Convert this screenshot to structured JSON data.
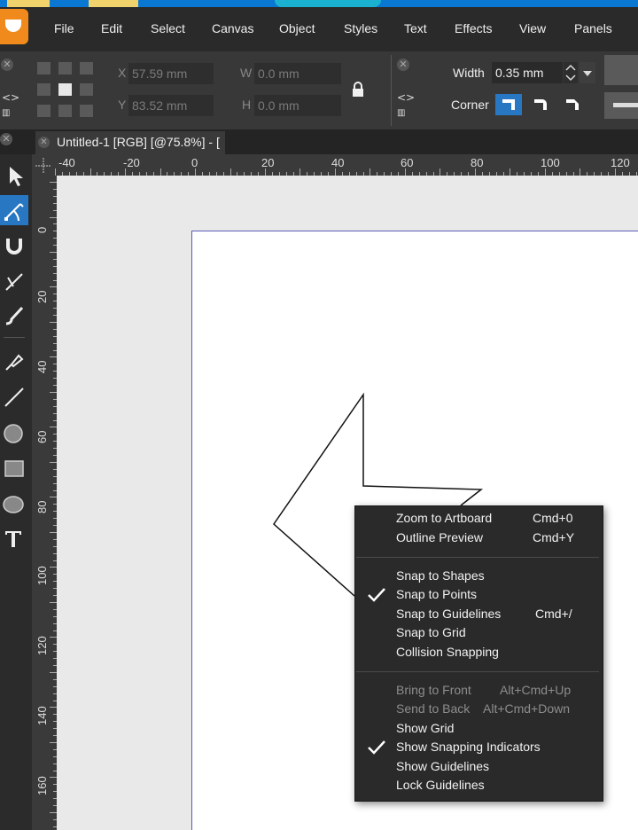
{
  "menu": {
    "items": [
      "File",
      "Edit",
      "Select",
      "Canvas",
      "Object",
      "Styles",
      "Text",
      "Effects",
      "View",
      "Panels"
    ]
  },
  "context_toolbar": {
    "x_label": "X",
    "x_value": "57.59 mm",
    "y_label": "Y",
    "y_value": "83.52 mm",
    "w_label": "W",
    "w_value": "0.0 mm",
    "h_label": "H",
    "h_value": "0.0 mm",
    "width_label": "Width",
    "width_value": "0.35 mm",
    "corner_label": "Corner"
  },
  "document_tab": {
    "title": "Untitled-1 [RGB] [@75.8%] - ["
  },
  "ruler": {
    "horizontal": [
      "-40",
      "-20",
      "0",
      "20",
      "40",
      "60",
      "80",
      "100",
      "120"
    ],
    "vertical": [
      "0",
      "20",
      "40",
      "60",
      "80",
      "100",
      "120",
      "140",
      "160"
    ]
  },
  "context_menu": {
    "group1": [
      {
        "label": "Zoom to Artboard",
        "shortcut": "Cmd+0",
        "enabled": true,
        "checked": false
      },
      {
        "label": "Outline Preview",
        "shortcut": "Cmd+Y",
        "enabled": true,
        "checked": false
      }
    ],
    "group2": [
      {
        "label": "Snap to Shapes",
        "shortcut": "",
        "enabled": true,
        "checked": false
      },
      {
        "label": "Snap to Points",
        "shortcut": "",
        "enabled": true,
        "checked": true
      },
      {
        "label": "Snap to Guidelines",
        "shortcut": "Cmd+/",
        "enabled": true,
        "checked": false
      },
      {
        "label": "Snap to Grid",
        "shortcut": "",
        "enabled": true,
        "checked": false
      },
      {
        "label": "Collision Snapping",
        "shortcut": "",
        "enabled": true,
        "checked": false
      }
    ],
    "group3": [
      {
        "label": "Bring to Front",
        "shortcut": "Alt+Cmd+Up",
        "enabled": false,
        "checked": false
      },
      {
        "label": "Send to Back",
        "shortcut": "Alt+Cmd+Down",
        "enabled": false,
        "checked": false
      },
      {
        "label": "Show Grid",
        "shortcut": "",
        "enabled": true,
        "checked": false
      },
      {
        "label": "Show Snapping Indicators",
        "shortcut": "",
        "enabled": true,
        "checked": true
      },
      {
        "label": "Show Guidelines",
        "shortcut": "",
        "enabled": true,
        "checked": false
      },
      {
        "label": "Lock Guidelines",
        "shortcut": "",
        "enabled": true,
        "checked": false
      }
    ]
  },
  "tools": [
    "select-arrow-icon",
    "node-tool-icon",
    "magnet-icon",
    "knife-icon",
    "brush-icon",
    "pen-icon",
    "line-icon",
    "circle-icon",
    "rectangle-icon",
    "ellipse-icon",
    "text-tool-icon"
  ],
  "colors": {
    "accent": "#2877c2",
    "menu_bg": "#2a2a2a",
    "toolbar_bg": "#383838",
    "logo": "#f08a1c"
  }
}
